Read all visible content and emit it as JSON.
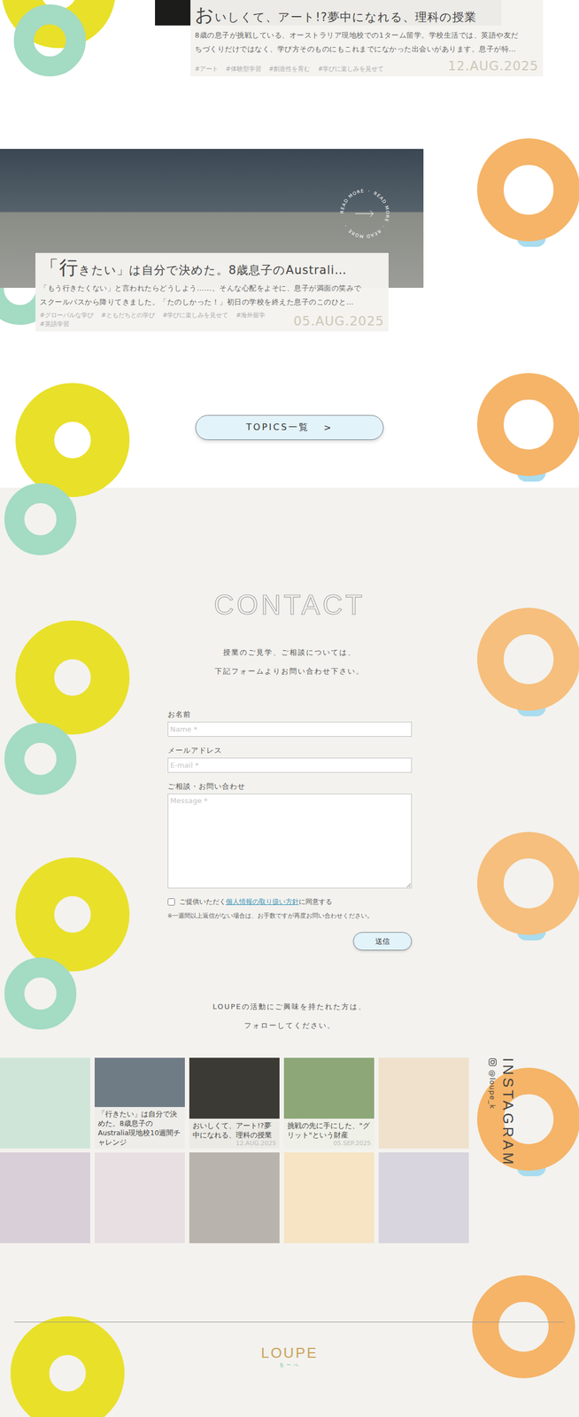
{
  "articles": [
    {
      "titleLead": "お",
      "titleRest": "いしくて、アート!?夢中になれる、理科の授業",
      "description": [
        "8歳の息子が挑戦している、オーストラリア現地校での1ターム留学。学校生活では、英語や友だ",
        "ちづくりだけではなく、学び方そのものにもこれまでになかった出会いがあります。息子が特…"
      ],
      "tags": [
        "#アート",
        "#体験型学習",
        "#創造性を育む",
        "#学びに楽しみを見せて"
      ],
      "date": "12.AUG.2025"
    },
    {
      "titleLead": "「行",
      "titleRest": "きたい」は自分で決めた。8歳息子のAustrali…",
      "description": [
        "「もう行きたくない」と言われたらどうしよう……。そんな心配をよそに、息子が満面の笑みで",
        "スクールバスから降りてきました。「たのしかった！」初日の学校を終えた息子のこのひと…"
      ],
      "tags": [
        "#グローバルな学び",
        "#ともだちとの学び",
        "#学びに楽しみを見せて",
        "#海外留学",
        "#英語学習"
      ],
      "date": "05.AUG.2025"
    }
  ],
  "readMore": "READ MORE ・ READ MORE ・ READ MORE ・",
  "topicsButton": {
    "label": "TOPICS一覧",
    "arrow": ">"
  },
  "contact": {
    "heading": "CONTACT",
    "intro": [
      "授業のご見学、ご相談については、",
      "下記フォームよりお問い合わせ下さい。"
    ],
    "fields": [
      {
        "label": "お名前",
        "placeholder": "Name *",
        "kind": "input"
      },
      {
        "label": "メールアドレス",
        "placeholder": "E-mail *",
        "kind": "input"
      },
      {
        "label": "ご相談・お問い合わせ",
        "placeholder": "Message *",
        "kind": "textarea"
      }
    ],
    "consent": {
      "before": "ご提供いただく",
      "link": "個人情報の取り扱い方針",
      "after": "に同意する",
      "checked": false
    },
    "note": "※一週間以上返信がない場合は、お手数ですが再度お問い合わせください。",
    "submit": "送信"
  },
  "instagram": {
    "intro": [
      "LOUPEの活動にご興味を持たれた方は、",
      "フォローしてください。"
    ],
    "label": "INSTAGRAM",
    "handle": "@loupe_k",
    "posts": [
      {
        "caption": "",
        "date": ""
      },
      {
        "caption": "「行きたい」は自分で決めた。8歳息子のAustralia現地校10週間チャレンジ",
        "date": ""
      },
      {
        "caption": "おいしくて、アート!?夢中になれる、理科の授業",
        "date": "12.AUG.2025"
      },
      {
        "caption": "挑戦の先に手にした、\"グリット\"という財産",
        "date": "05.SEP.2025"
      },
      {
        "caption": "",
        "date": ""
      },
      {
        "caption": "",
        "date": ""
      },
      {
        "caption": "",
        "date": ""
      },
      {
        "caption": "",
        "date": ""
      },
      {
        "caption": "",
        "date": ""
      },
      {
        "caption": "",
        "date": ""
      }
    ]
  },
  "footer": {
    "logo": "LOUPE",
    "sub": "るーぺ"
  }
}
